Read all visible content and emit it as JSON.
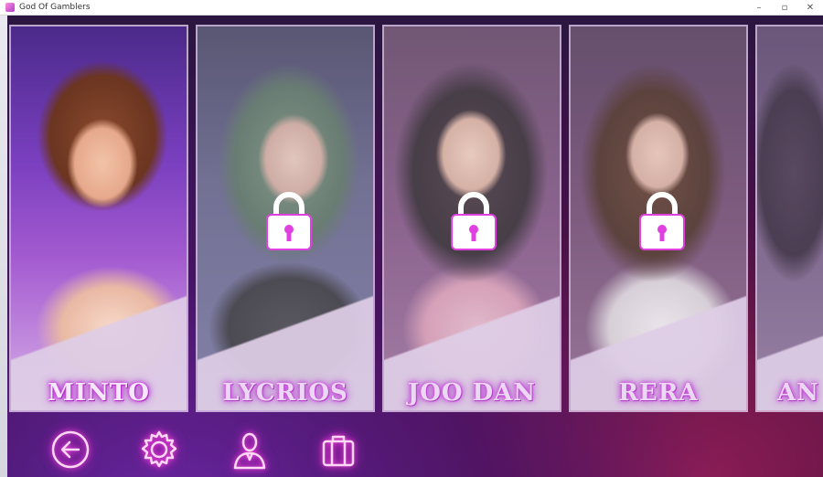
{
  "window": {
    "title": "God Of Gamblers"
  },
  "cards": [
    {
      "name": "MINTO",
      "locked": false
    },
    {
      "name": "LYCRIOS",
      "locked": true
    },
    {
      "name": "JOO DAN",
      "locked": true
    },
    {
      "name": "RERA",
      "locked": true
    },
    {
      "name": "AN",
      "locked": true
    }
  ],
  "icons": {
    "back": "back-arrow-icon",
    "settings": "gear-icon",
    "profile": "user-icon",
    "inventory": "briefcase-icon",
    "lock": "lock-icon"
  },
  "colors": {
    "neon_pink": "#ff4ae0",
    "name_glow": "#c030d8",
    "accent_purple": "#8a1aa0"
  }
}
